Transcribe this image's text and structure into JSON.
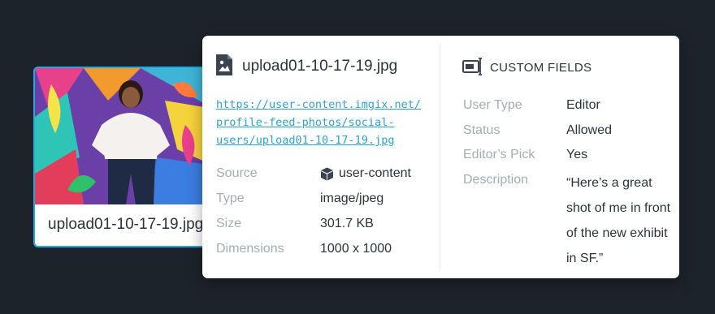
{
  "thumbnail": {
    "filename": "upload01-10-17-19.jpg",
    "image_description_icon": "photo-thumbnail"
  },
  "details": {
    "filename": "upload01-10-17-19.jpg",
    "file_icon": "image-file-icon",
    "url_lines": [
      "https://user-content.imgix.net/",
      "profile-feed-photos/social-",
      "users/upload01-10-17-19.jpg"
    ],
    "meta": [
      {
        "label": "Source",
        "value": "user-content"
      },
      {
        "label": "Type",
        "value": "image/jpeg"
      },
      {
        "label": "Size",
        "value": "301.7 KB"
      },
      {
        "label": "Dimensions",
        "value": "1000 x 1000"
      }
    ]
  },
  "custom_fields": {
    "title": "CUSTOM FIELDS",
    "fields": [
      {
        "label": "User Type",
        "value": "Editor"
      },
      {
        "label": "Status",
        "value": "Allowed"
      },
      {
        "label": "Editor’s Pick",
        "value": "Yes"
      },
      {
        "label": "Description",
        "value": "“Here’s a great shot of me in front of the new exhibit in SF.”"
      }
    ]
  },
  "colors": {
    "background": "#1c232a",
    "accent_border": "#22a8e0",
    "link": "#2aa3d6",
    "label": "#a3adb6",
    "text": "#2b333b"
  }
}
